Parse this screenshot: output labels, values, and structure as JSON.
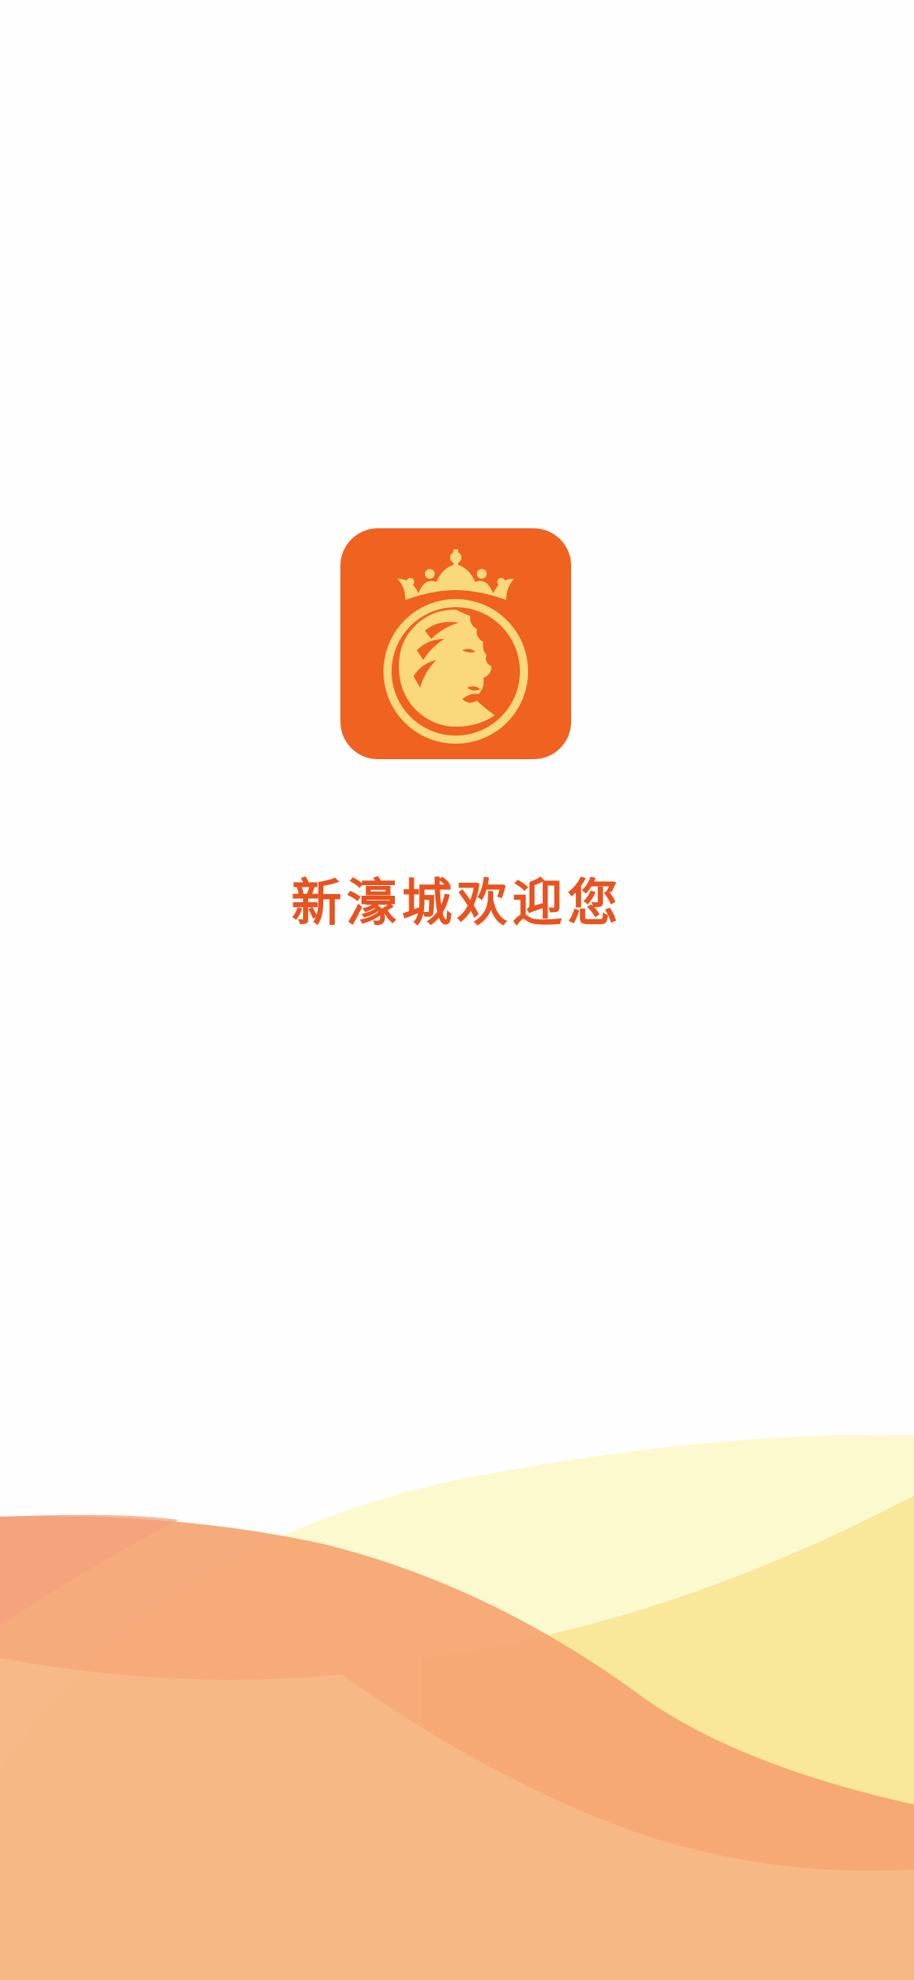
{
  "splash": {
    "welcome_text": "新濠城欢迎您",
    "logo_icon": "lion-crown-icon"
  },
  "colors": {
    "accent": "#f0621f",
    "logo_gold": "#fad97d",
    "welcome_text": "#e8531f",
    "wave_light_yellow": "#fdf9cf",
    "wave_yellow": "#f9e79a",
    "wave_orange": "#f5a873",
    "wave_peach": "#f6be8a"
  }
}
